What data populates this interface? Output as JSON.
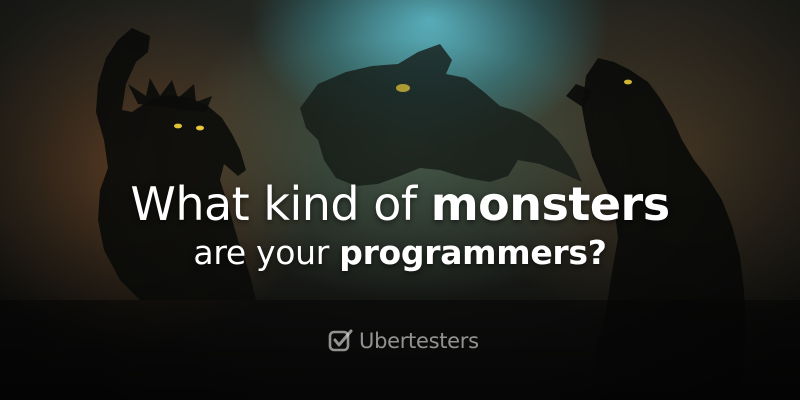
{
  "headline": {
    "line1_regular": "What kind of ",
    "line1_bold": "monsters",
    "line2_regular": "are your ",
    "line2_bold": "programmers?"
  },
  "brand": {
    "name": "Ubertesters",
    "icon": "checkbox-icon"
  },
  "colors": {
    "text": "#ffffff",
    "glow_teal": "#5fbecd",
    "eyes": "#e8c83a"
  }
}
